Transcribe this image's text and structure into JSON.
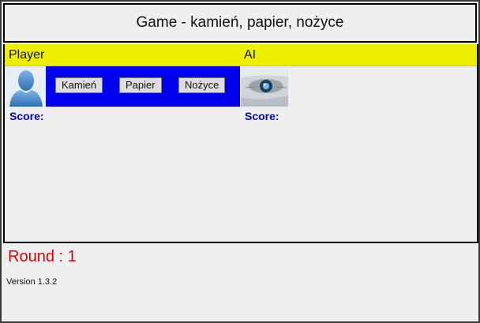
{
  "header": {
    "title": "Game - kamień, papier, nożyce"
  },
  "player": {
    "label": "Player",
    "score_label": "Score:",
    "buttons": {
      "rock": "Kamień",
      "paper": "Papier",
      "scissors": "Nożyce"
    }
  },
  "ai": {
    "label": "AI",
    "score_label": "Score:"
  },
  "footer": {
    "round": "Round : 1",
    "version": "Version 1.3.2"
  },
  "colors": {
    "title_bar": "#eeee00",
    "controls_bg": "#0000ee",
    "score_text": "#0000cc",
    "round_text": "#e00000"
  }
}
